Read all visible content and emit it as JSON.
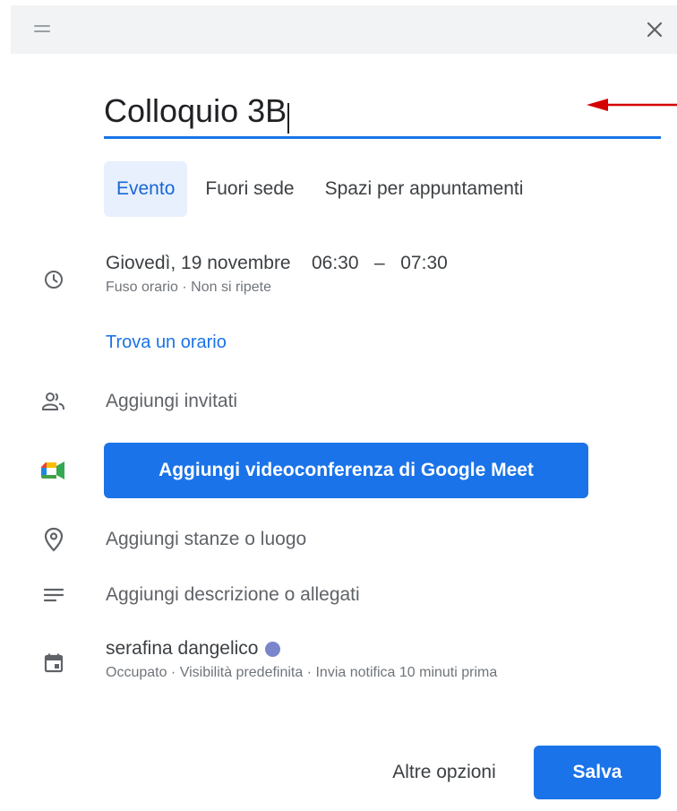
{
  "header": {
    "drag_icon": "drag-handle-icon",
    "close_icon": "close-icon"
  },
  "title": {
    "value": "Colloquio 3B"
  },
  "tabs": [
    {
      "label": "Evento",
      "active": true
    },
    {
      "label": "Fuori sede",
      "active": false
    },
    {
      "label": "Spazi per appuntamenti",
      "active": false
    }
  ],
  "time": {
    "date": "Giovedì, 19 novembre",
    "start": "06:30",
    "separator": "–",
    "end": "07:30",
    "timezone": "Fuso orario",
    "dot_sep": "·",
    "repeat": "Non si ripete",
    "find_time": "Trova un orario"
  },
  "guests": {
    "label": "Aggiungi invitati"
  },
  "meet": {
    "button_label": "Aggiungi videoconferenza di Google Meet"
  },
  "location": {
    "label": "Aggiungi stanze o luogo"
  },
  "description": {
    "label": "Aggiungi descrizione o allegati"
  },
  "calendar": {
    "owner": "serafina dangelico",
    "color": "#7986cb",
    "details": "Occupato · Visibilità predefinita · Invia notifica 10 minuti prima"
  },
  "footer": {
    "more_label": "Altre opzioni",
    "save_label": "Salva"
  },
  "colors": {
    "accent": "#1a73e8",
    "arrow": "#d50000",
    "tab_active_bg": "#e8f0fe"
  }
}
